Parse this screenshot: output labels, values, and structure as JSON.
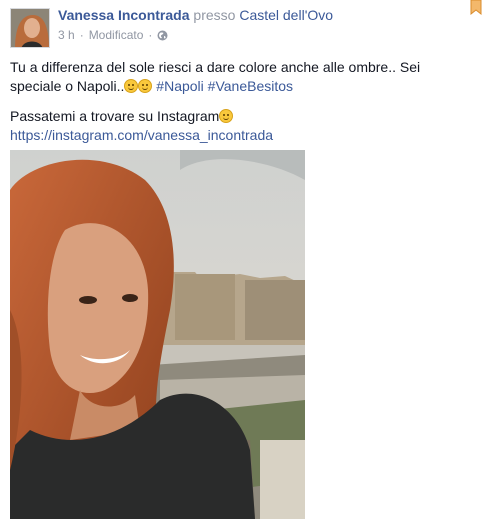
{
  "post": {
    "author": "Vanessa Incontrada",
    "presso": "presso",
    "place": "Castel dell'Ovo",
    "time": "3 h",
    "edited": "Modificato",
    "privacy_icon": "globe-icon",
    "text_line1": "Tu a differenza del sole riesci a dare colore anche alle ombre.. Sei speciale o Napoli..",
    "hashtags": [
      "#Napoli",
      "#VaneBesitos"
    ],
    "text_line2": "Passatemi a trovare su Instagram",
    "link": "https://instagram.com/vanessa_incontrada",
    "emoji_icon": "smiley-emoji-icon"
  },
  "colors": {
    "link": "#3b5998",
    "meta": "#9197a3",
    "text": "#141823"
  }
}
